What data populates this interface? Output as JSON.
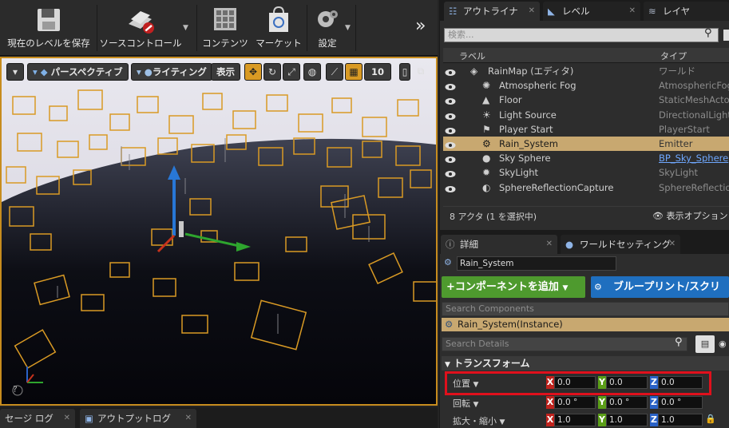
{
  "toolbar": {
    "save_level": "現在のレベルを保存",
    "source_control": "ソースコントロール",
    "contents": "コンテンツ",
    "marketplace": "マーケット",
    "settings": "設定",
    "expand": "»"
  },
  "viewport": {
    "perspective": "パースペクティブ",
    "lighting": "ライティング",
    "show": "表示",
    "grid_snap_value": "10",
    "help": "?"
  },
  "bottom_tabs": {
    "message_log": "セージ ログ",
    "output_log": "アウトプットログ"
  },
  "right_tabs": {
    "outliner": "アウトライナ",
    "levels": "レベル",
    "layers": "レイヤ"
  },
  "outliner": {
    "search_placeholder": "検索...",
    "col_label": "ラベル",
    "col_type": "タイプ",
    "items": [
      {
        "label": "RainMap (エディタ)",
        "type": "ワールド"
      },
      {
        "label": "Atmospheric Fog",
        "type": "AtmosphericFog"
      },
      {
        "label": "Floor",
        "type": "StaticMeshActor"
      },
      {
        "label": "Light Source",
        "type": "DirectionalLight"
      },
      {
        "label": "Player Start",
        "type": "PlayerStart"
      },
      {
        "label": "Rain_System",
        "type": "Emitter"
      },
      {
        "label": "Sky Sphere",
        "type": "BP_Sky_Sphere"
      },
      {
        "label": "SkyLight",
        "type": "SkyLight"
      },
      {
        "label": "SphereReflectionCapture",
        "type": "SphereReflection"
      }
    ],
    "status": "8 アクタ (1 を選択中)",
    "view_options": "表示オプション"
  },
  "details_tabs": {
    "details": "詳細",
    "world_settings": "ワールドセッティング"
  },
  "details": {
    "actor_name": "Rain_System",
    "add_component": "+コンポーネントを追加",
    "blueprint": "ブループリント/スクリ",
    "search_components": "Search Components",
    "instance": "Rain_System(Instance)",
    "search_details": "Search Details",
    "transform_header": "トランスフォーム",
    "location": {
      "label": "位置",
      "x": "0.0",
      "y": "0.0",
      "z": "0.0"
    },
    "rotation": {
      "label": "回転",
      "x": "0.0 °",
      "y": "0.0 °",
      "z": "0.0 °"
    },
    "scale": {
      "label": "拡大・縮小",
      "x": "1.0",
      "y": "1.0",
      "z": "1.0"
    }
  },
  "colors": {
    "selection_orange": "#c78c1e",
    "add_component_green": "#4e9a2e",
    "blueprint_blue": "#1f6fbf",
    "highlight_red": "#e0101c",
    "axis_x": "#c0231d",
    "axis_y": "#5b9e18",
    "axis_z": "#2a62c7"
  }
}
